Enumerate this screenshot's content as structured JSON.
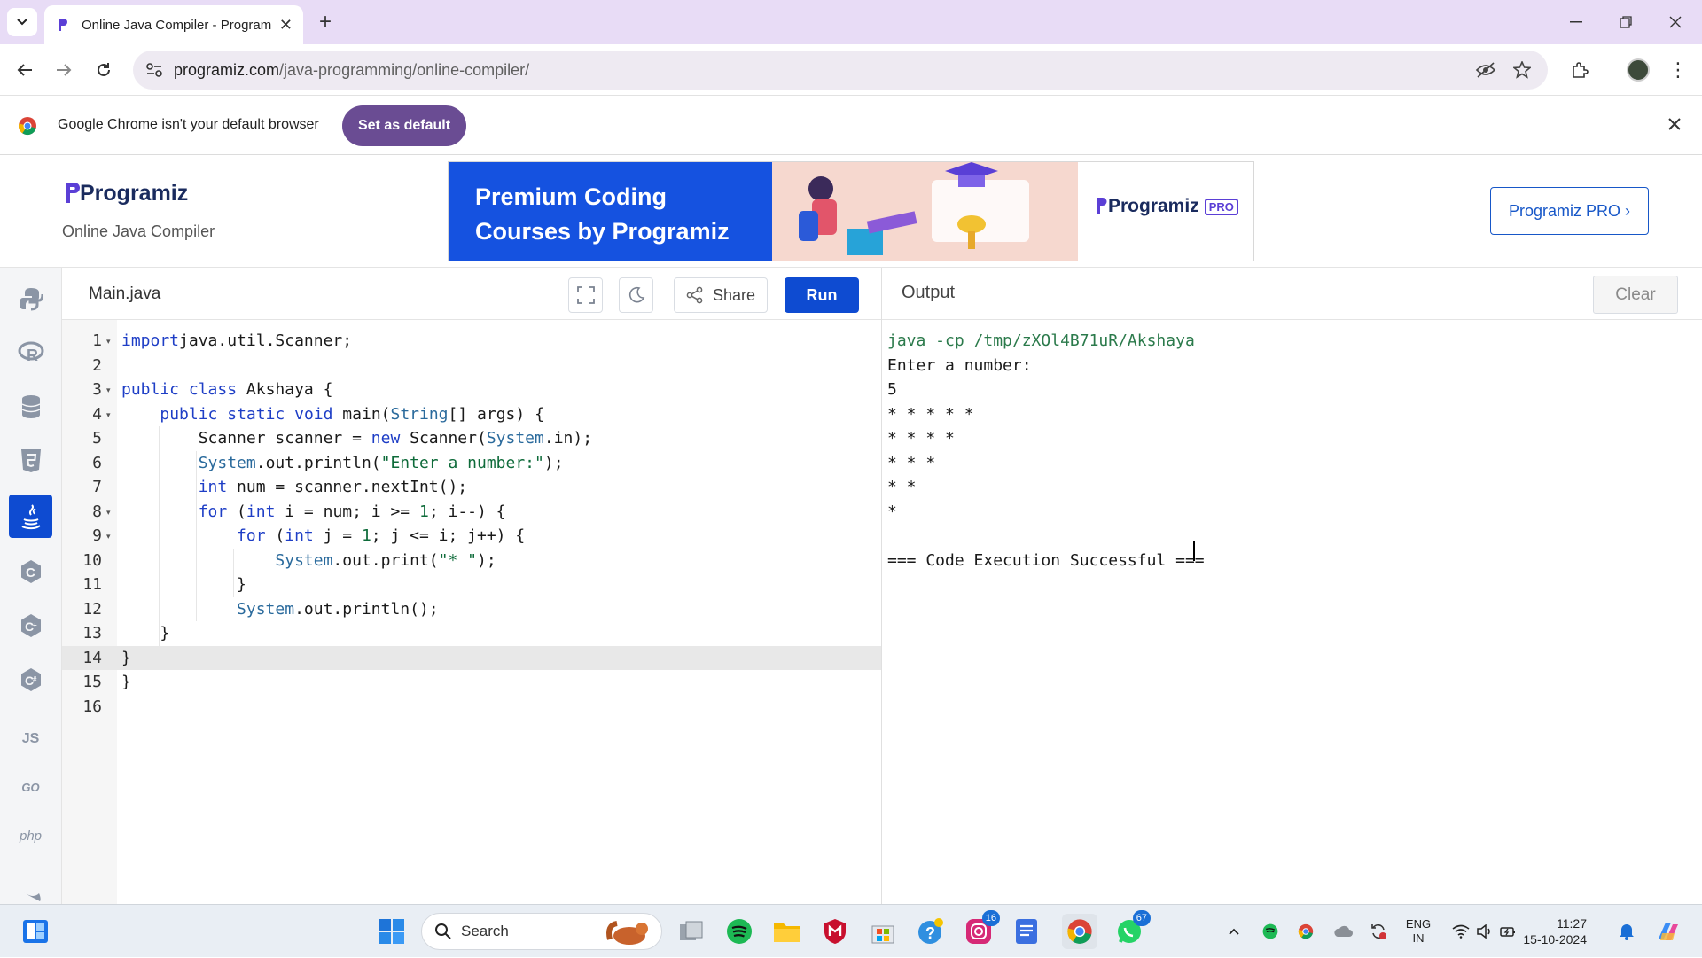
{
  "browser": {
    "tab_title": "Online Java Compiler - Program",
    "url_host": "programiz.com",
    "url_path": "/java-programming/online-compiler/",
    "infobar_text": "Google Chrome isn't your default browser",
    "set_default_label": "Set as default"
  },
  "site": {
    "logo_text": "Programiz",
    "subtitle": "Online Java Compiler",
    "banner_line1": "Premium Coding",
    "banner_line2": "Courses by Programiz",
    "banner_logo": "Programiz",
    "banner_pro": "PRO",
    "pro_button": "Programiz PRO ›"
  },
  "rail": [
    "python-icon",
    "r-icon",
    "sql-icon",
    "html-icon",
    "java-icon",
    "c-icon",
    "cpp-icon",
    "csharp-icon",
    "js-icon",
    "go-icon",
    "php-icon",
    "swift-icon"
  ],
  "rail_labels": {
    "js": "JS",
    "go": "GO",
    "php": "php"
  },
  "editor": {
    "file_name": "Main.java",
    "share_label": "Share",
    "run_label": "Run",
    "line_numbers": [
      "1",
      "2",
      "3",
      "4",
      "5",
      "6",
      "7",
      "8",
      "9",
      "10",
      "11",
      "12",
      "13",
      "14",
      "15",
      "16"
    ],
    "current_line": 14
  },
  "code": [
    [
      [
        "kw",
        "import"
      ],
      [
        "",
        "java.util.Scanner;"
      ]
    ],
    [],
    [
      [
        "kw",
        "public"
      ],
      [
        "",
        " "
      ],
      [
        "kw",
        "class"
      ],
      [
        "",
        " Akshaya {"
      ]
    ],
    [
      [
        "",
        "    "
      ],
      [
        "kw",
        "public"
      ],
      [
        "",
        " "
      ],
      [
        "kw",
        "static"
      ],
      [
        "",
        " "
      ],
      [
        "kw",
        "void"
      ],
      [
        "",
        " main("
      ],
      [
        "ty",
        "String"
      ],
      [
        "",
        "[] args) {"
      ]
    ],
    [
      [
        "",
        "        Scanner scanner = "
      ],
      [
        "kw",
        "new"
      ],
      [
        "",
        " Scanner("
      ],
      [
        "ty",
        "System"
      ],
      [
        "",
        ".in);"
      ]
    ],
    [
      [
        "",
        "        "
      ],
      [
        "ty",
        "System"
      ],
      [
        "",
        ".out.println("
      ],
      [
        "st",
        "\"Enter a number:\""
      ],
      [
        "",
        ");"
      ]
    ],
    [
      [
        "",
        "        "
      ],
      [
        "kw",
        "int"
      ],
      [
        "",
        " num = scanner.nextInt();"
      ]
    ],
    [
      [
        "",
        "        "
      ],
      [
        "kw",
        "for"
      ],
      [
        "",
        " ("
      ],
      [
        "kw",
        "int"
      ],
      [
        "",
        " i = num; i >= "
      ],
      [
        "nm",
        "1"
      ],
      [
        "",
        "; i--) {"
      ]
    ],
    [
      [
        "",
        "            "
      ],
      [
        "kw",
        "for"
      ],
      [
        "",
        " ("
      ],
      [
        "kw",
        "int"
      ],
      [
        "",
        " j = "
      ],
      [
        "nm",
        "1"
      ],
      [
        "",
        "; j <= i; j++) {"
      ]
    ],
    [
      [
        "",
        "                "
      ],
      [
        "ty",
        "System"
      ],
      [
        "",
        ".out.print("
      ],
      [
        "st",
        "\"* \""
      ],
      [
        "",
        ");"
      ]
    ],
    [
      [
        "",
        "            }"
      ]
    ],
    [
      [
        "",
        "            "
      ],
      [
        "ty",
        "System"
      ],
      [
        "",
        ".out.println();"
      ]
    ],
    [
      [
        "",
        "    }"
      ]
    ],
    [
      [
        "",
        "}"
      ]
    ],
    [
      [
        "",
        "}"
      ]
    ],
    []
  ],
  "output": {
    "title": "Output",
    "clear_label": "Clear",
    "lines": [
      "java -cp /tmp/zXOl4B71uR/Akshaya",
      "Enter a number:",
      "5",
      "* * * * *",
      "* * * *",
      "* * *",
      "* *",
      "*",
      "",
      "=== Code Execution Successful ==="
    ],
    "command_color": "#2b7a4b"
  },
  "taskbar": {
    "search_placeholder": "Search",
    "instagram_badge": "16",
    "whatsapp_badge": "67",
    "lang_top": "ENG",
    "lang_bottom": "IN",
    "time": "11:27",
    "date": "15-10-2024"
  },
  "colors": {
    "accent": "#0e4bd1",
    "brand_purple": "#6a4c93",
    "java_active": "#0e4bd1"
  }
}
